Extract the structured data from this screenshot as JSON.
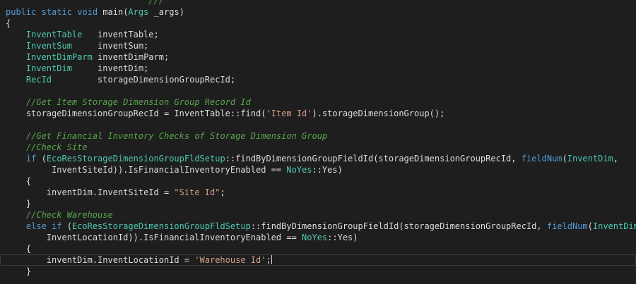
{
  "editor": {
    "background": "#1e1e1e",
    "colors": {
      "keyword": "#569cd6",
      "type": "#4ec9b0",
      "comment": "#57a64a",
      "string": "#d69d85",
      "plain": "#dcdcdc"
    },
    "lines": [
      {
        "tokens": [
          {
            "k": "comment",
            "t": "                            ///  "
          }
        ]
      },
      {
        "tokens": [
          {
            "k": "keyword",
            "t": "public"
          },
          {
            "k": "plain",
            "t": " "
          },
          {
            "k": "keyword",
            "t": "static"
          },
          {
            "k": "plain",
            "t": " "
          },
          {
            "k": "keyword",
            "t": "void"
          },
          {
            "k": "plain",
            "t": " main("
          },
          {
            "k": "type",
            "t": "Args"
          },
          {
            "k": "plain",
            "t": " _args)"
          }
        ]
      },
      {
        "tokens": [
          {
            "k": "plain",
            "t": "{"
          }
        ]
      },
      {
        "tokens": [
          {
            "k": "plain",
            "t": "    "
          },
          {
            "k": "type",
            "t": "InventTable"
          },
          {
            "k": "plain",
            "t": "   inventTable;"
          }
        ]
      },
      {
        "tokens": [
          {
            "k": "plain",
            "t": "    "
          },
          {
            "k": "type",
            "t": "InventSum"
          },
          {
            "k": "plain",
            "t": "     inventSum;"
          }
        ]
      },
      {
        "tokens": [
          {
            "k": "plain",
            "t": "    "
          },
          {
            "k": "type",
            "t": "InventDimParm"
          },
          {
            "k": "plain",
            "t": " inventDimParm;"
          }
        ]
      },
      {
        "tokens": [
          {
            "k": "plain",
            "t": "    "
          },
          {
            "k": "type",
            "t": "InventDim"
          },
          {
            "k": "plain",
            "t": "     inventDim;"
          }
        ]
      },
      {
        "tokens": [
          {
            "k": "plain",
            "t": "    "
          },
          {
            "k": "type",
            "t": "RecId"
          },
          {
            "k": "plain",
            "t": "         storageDimensionGroupRecId;"
          }
        ]
      },
      {
        "tokens": []
      },
      {
        "tokens": [
          {
            "k": "plain",
            "t": "    "
          },
          {
            "k": "comment",
            "t": "//Get Item Storage Dimension Group Record Id"
          }
        ]
      },
      {
        "tokens": [
          {
            "k": "plain",
            "t": "    storageDimensionGroupRecId = InventTable::find("
          },
          {
            "k": "string",
            "t": "'Item Id'"
          },
          {
            "k": "plain",
            "t": ").storageDimensionGroup();"
          }
        ]
      },
      {
        "tokens": []
      },
      {
        "tokens": [
          {
            "k": "plain",
            "t": "    "
          },
          {
            "k": "comment",
            "t": "//Get Financial Inventory Checks of Storage Dimension Group"
          }
        ]
      },
      {
        "tokens": [
          {
            "k": "plain",
            "t": "    "
          },
          {
            "k": "comment",
            "t": "//Check Site"
          }
        ]
      },
      {
        "tokens": [
          {
            "k": "plain",
            "t": "    "
          },
          {
            "k": "keyword",
            "t": "if"
          },
          {
            "k": "plain",
            "t": " ("
          },
          {
            "k": "type",
            "t": "EcoResStorageDimensionGroupFldSetup"
          },
          {
            "k": "plain",
            "t": "::findByDimensionGroupFieldId(storageDimensionGroupRecId, "
          },
          {
            "k": "keyword",
            "t": "fieldNum"
          },
          {
            "k": "plain",
            "t": "("
          },
          {
            "k": "type",
            "t": "InventDim"
          },
          {
            "k": "plain",
            "t": ","
          }
        ]
      },
      {
        "tokens": [
          {
            "k": "plain",
            "t": "         InventSiteId)).IsFinancialInventoryEnabled == "
          },
          {
            "k": "type",
            "t": "NoYes"
          },
          {
            "k": "plain",
            "t": "::Yes)"
          }
        ]
      },
      {
        "tokens": [
          {
            "k": "plain",
            "t": "    {"
          }
        ]
      },
      {
        "tokens": [
          {
            "k": "plain",
            "t": "        inventDim.InventSiteId = "
          },
          {
            "k": "string",
            "t": "\"Site Id\""
          },
          {
            "k": "plain",
            "t": ";"
          }
        ]
      },
      {
        "tokens": [
          {
            "k": "plain",
            "t": "    }"
          }
        ]
      },
      {
        "tokens": [
          {
            "k": "plain",
            "t": "    "
          },
          {
            "k": "comment",
            "t": "//Check Warehouse"
          }
        ]
      },
      {
        "tokens": [
          {
            "k": "plain",
            "t": "    "
          },
          {
            "k": "keyword",
            "t": "else if"
          },
          {
            "k": "plain",
            "t": " ("
          },
          {
            "k": "type",
            "t": "EcoResStorageDimensionGroupFldSetup"
          },
          {
            "k": "plain",
            "t": "::findByDimensionGroupFieldId(storageDimensionGroupRecId, "
          },
          {
            "k": "keyword",
            "t": "fieldNum"
          },
          {
            "k": "plain",
            "t": "("
          },
          {
            "k": "type",
            "t": "InventDim"
          },
          {
            "k": "plain",
            "t": ","
          }
        ]
      },
      {
        "tokens": [
          {
            "k": "plain",
            "t": "        InventLocationId)).IsFinancialInventoryEnabled == "
          },
          {
            "k": "type",
            "t": "NoYes"
          },
          {
            "k": "plain",
            "t": "::Yes)"
          }
        ]
      },
      {
        "tokens": [
          {
            "k": "plain",
            "t": "    {"
          }
        ]
      },
      {
        "tokens": [
          {
            "k": "plain",
            "t": "        inventDim.InventLocationId = "
          },
          {
            "k": "string",
            "t": "'Warehouse Id'"
          },
          {
            "k": "plain",
            "t": ";"
          }
        ],
        "current": true,
        "caret": true
      },
      {
        "tokens": [
          {
            "k": "plain",
            "t": "    }"
          }
        ]
      }
    ]
  }
}
